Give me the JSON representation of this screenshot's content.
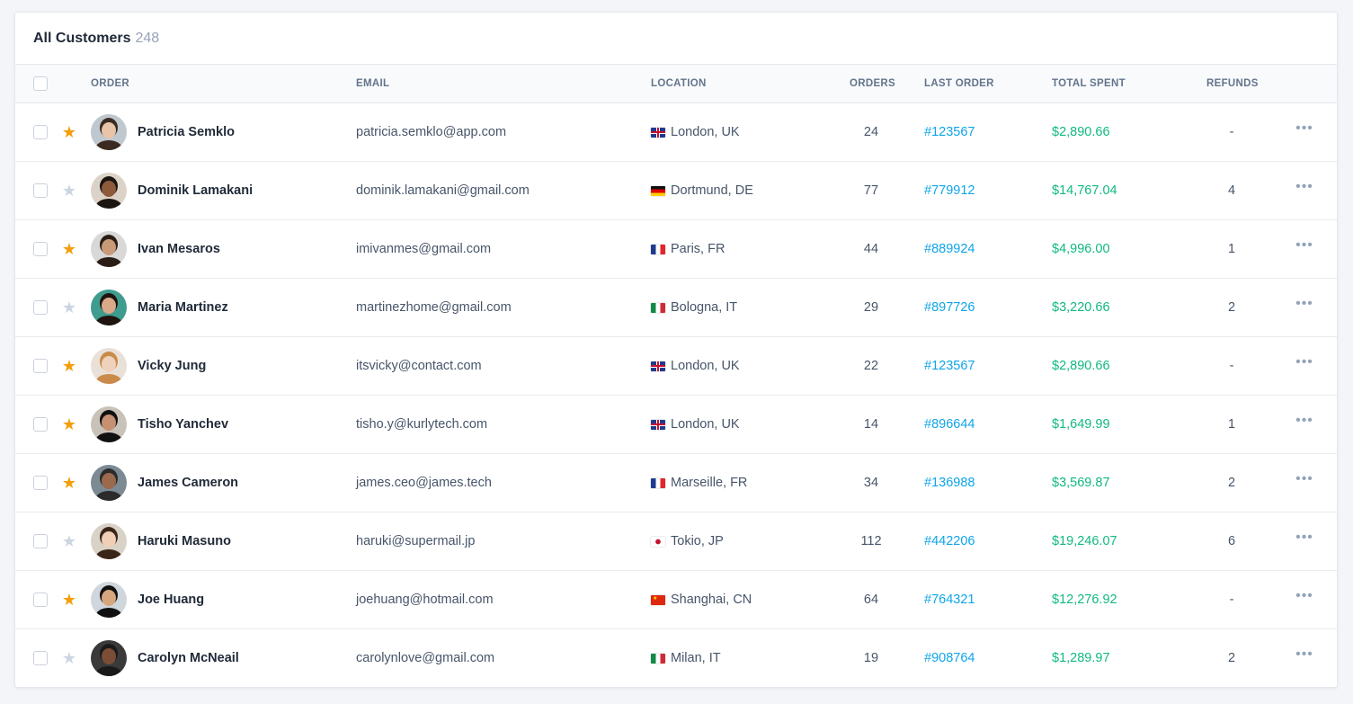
{
  "header": {
    "title": "All Customers",
    "count": "248"
  },
  "columns": {
    "order": "ORDER",
    "email": "EMAIL",
    "location": "LOCATION",
    "orders": "ORDERS",
    "last_order": "LAST ORDER",
    "total_spent": "TOTAL SPENT",
    "refunds": "REFUNDS"
  },
  "colors": {
    "star_on": "#f59e0b",
    "star_off": "#cbd5e1",
    "link": "#0ea5e9",
    "money": "#10b981"
  },
  "more_icon": "ellipsis-icon",
  "rows": [
    {
      "starred": true,
      "avatar": "avatar-photo",
      "name": "Patricia Semklo",
      "email": "patricia.semklo@app.com",
      "flag": "uk",
      "location": "London, UK",
      "orders": "24",
      "last_order": "#123567",
      "total": "$2,890.66",
      "refunds": "-"
    },
    {
      "starred": false,
      "avatar": "avatar-photo",
      "name": "Dominik Lamakani",
      "email": "dominik.lamakani@gmail.com",
      "flag": "de",
      "location": "Dortmund, DE",
      "orders": "77",
      "last_order": "#779912",
      "total": "$14,767.04",
      "refunds": "4"
    },
    {
      "starred": true,
      "avatar": "avatar-photo",
      "name": "Ivan Mesaros",
      "email": "imivanmes@gmail.com",
      "flag": "fr",
      "location": "Paris, FR",
      "orders": "44",
      "last_order": "#889924",
      "total": "$4,996.00",
      "refunds": "1"
    },
    {
      "starred": false,
      "avatar": "avatar-photo",
      "name": "Maria Martinez",
      "email": "martinezhome@gmail.com",
      "flag": "it",
      "location": "Bologna, IT",
      "orders": "29",
      "last_order": "#897726",
      "total": "$3,220.66",
      "refunds": "2"
    },
    {
      "starred": true,
      "avatar": "avatar-photo",
      "name": "Vicky Jung",
      "email": "itsvicky@contact.com",
      "flag": "uk",
      "location": "London, UK",
      "orders": "22",
      "last_order": "#123567",
      "total": "$2,890.66",
      "refunds": "-"
    },
    {
      "starred": true,
      "avatar": "avatar-photo",
      "name": "Tisho Yanchev",
      "email": "tisho.y@kurlytech.com",
      "flag": "uk",
      "location": "London, UK",
      "orders": "14",
      "last_order": "#896644",
      "total": "$1,649.99",
      "refunds": "1"
    },
    {
      "starred": true,
      "avatar": "avatar-photo",
      "name": "James Cameron",
      "email": "james.ceo@james.tech",
      "flag": "fr",
      "location": "Marseille, FR",
      "orders": "34",
      "last_order": "#136988",
      "total": "$3,569.87",
      "refunds": "2"
    },
    {
      "starred": false,
      "avatar": "avatar-photo",
      "name": "Haruki Masuno",
      "email": "haruki@supermail.jp",
      "flag": "jp",
      "location": "Tokio, JP",
      "orders": "112",
      "last_order": "#442206",
      "total": "$19,246.07",
      "refunds": "6"
    },
    {
      "starred": true,
      "avatar": "avatar-photo",
      "name": "Joe Huang",
      "email": "joehuang@hotmail.com",
      "flag": "cn",
      "location": "Shanghai, CN",
      "orders": "64",
      "last_order": "#764321",
      "total": "$12,276.92",
      "refunds": "-"
    },
    {
      "starred": false,
      "avatar": "avatar-photo",
      "name": "Carolyn McNeail",
      "email": "carolynlove@gmail.com",
      "flag": "it",
      "location": "Milan, IT",
      "orders": "19",
      "last_order": "#908764",
      "total": "$1,289.97",
      "refunds": "2"
    }
  ]
}
